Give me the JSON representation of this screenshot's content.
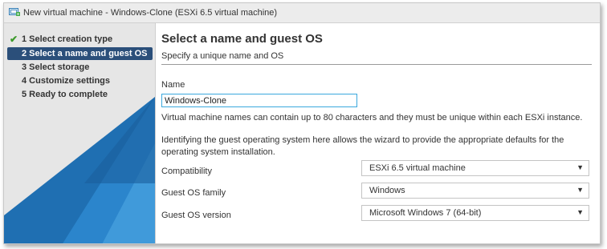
{
  "window": {
    "title": "New virtual machine - Windows-Clone (ESXi 6.5 virtual machine)"
  },
  "steps": [
    {
      "label": "1 Select creation type",
      "completed": true
    },
    {
      "label": "2 Select a name and guest OS",
      "active": true
    },
    {
      "label": "3 Select storage"
    },
    {
      "label": "4 Customize settings"
    },
    {
      "label": "5 Ready to complete"
    }
  ],
  "page": {
    "title": "Select a name and guest OS",
    "subtitle": "Specify a unique name and OS"
  },
  "name_field": {
    "label": "Name",
    "value": "Windows-Clone",
    "help": "Virtual machine names can contain up to 80 characters and they must be unique within each ESXi instance."
  },
  "os_help": "Identifying the guest operating system here allows the wizard to provide the appropriate defaults for the operating system installation.",
  "compatibility": {
    "label": "Compatibility",
    "value": "ESXi 6.5 virtual machine"
  },
  "os_family": {
    "label": "Guest OS family",
    "value": "Windows"
  },
  "os_version": {
    "label": "Guest OS version",
    "value": "Microsoft Windows 7 (64-bit)"
  },
  "icons": {
    "check": "✔",
    "caret": "▼"
  },
  "colors": {
    "active_step": "#2b4f7a",
    "input_border": "#3aa8dd",
    "check": "#3c9a2a"
  }
}
